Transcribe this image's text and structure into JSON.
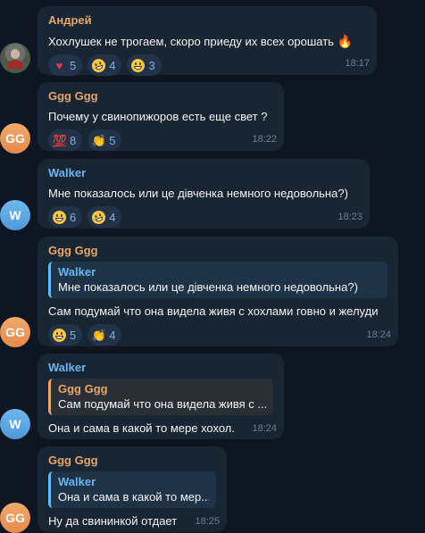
{
  "messages": [
    {
      "sender": "Андрей",
      "avatar": "",
      "text": "Хохлушек не трогаем, скоро приеду их всех орошать",
      "trailing_emoji": "fire",
      "time": "18:17",
      "reactions": [
        {
          "emoji": "red-heart",
          "count": "5"
        },
        {
          "emoji": "rolling-laughing",
          "count": "4"
        },
        {
          "emoji": "grinning-face",
          "count": "3"
        }
      ]
    },
    {
      "sender": "Ggg Ggg",
      "avatar": "GG",
      "text": "Почему у свинопижоров есть еще свет ?",
      "time": "18:22",
      "reactions": [
        {
          "emoji": "hundred-points",
          "count": "8"
        },
        {
          "emoji": "clapping-hands",
          "count": "5"
        }
      ]
    },
    {
      "sender": "Walker",
      "avatar": "W",
      "text": "Мне показалось или це дівченка немного недовольна?)",
      "time": "18:23",
      "reactions": [
        {
          "emoji": "grinning-face",
          "count": "6"
        },
        {
          "emoji": "rolling-laughing",
          "count": "4"
        }
      ]
    },
    {
      "sender": "Ggg Ggg",
      "avatar": "GG",
      "quote_name": "Walker",
      "quote_text": "Мне показалось или це дівченка немного недовольна?)",
      "text": "Сам подумай что она видела живя с хохлами говно и желуди",
      "time": "18:24",
      "reactions": [
        {
          "emoji": "grinning-face",
          "count": "5"
        },
        {
          "emoji": "clapping-hands",
          "count": "4"
        }
      ]
    },
    {
      "sender": "Walker",
      "avatar": "W",
      "quote_name": "Ggg Ggg",
      "quote_text": "Сам подумай что она видела живя с ...",
      "text": "Она и сама в какой то мере хохол.",
      "time": "18:24"
    },
    {
      "sender": "Ggg Ggg",
      "avatar": "GG",
      "quote_name": "Walker",
      "quote_text": "Она и сама в какой то мер...",
      "text": "Ну да свининкой отдает",
      "time": "18:25"
    }
  ],
  "colors": {
    "background": "#0e1621",
    "bubble": "#182533",
    "name_orange": "#e7a56b",
    "name_blue": "#67b8f1",
    "reaction_bg": "#223247",
    "time": "#6d7f8f"
  }
}
